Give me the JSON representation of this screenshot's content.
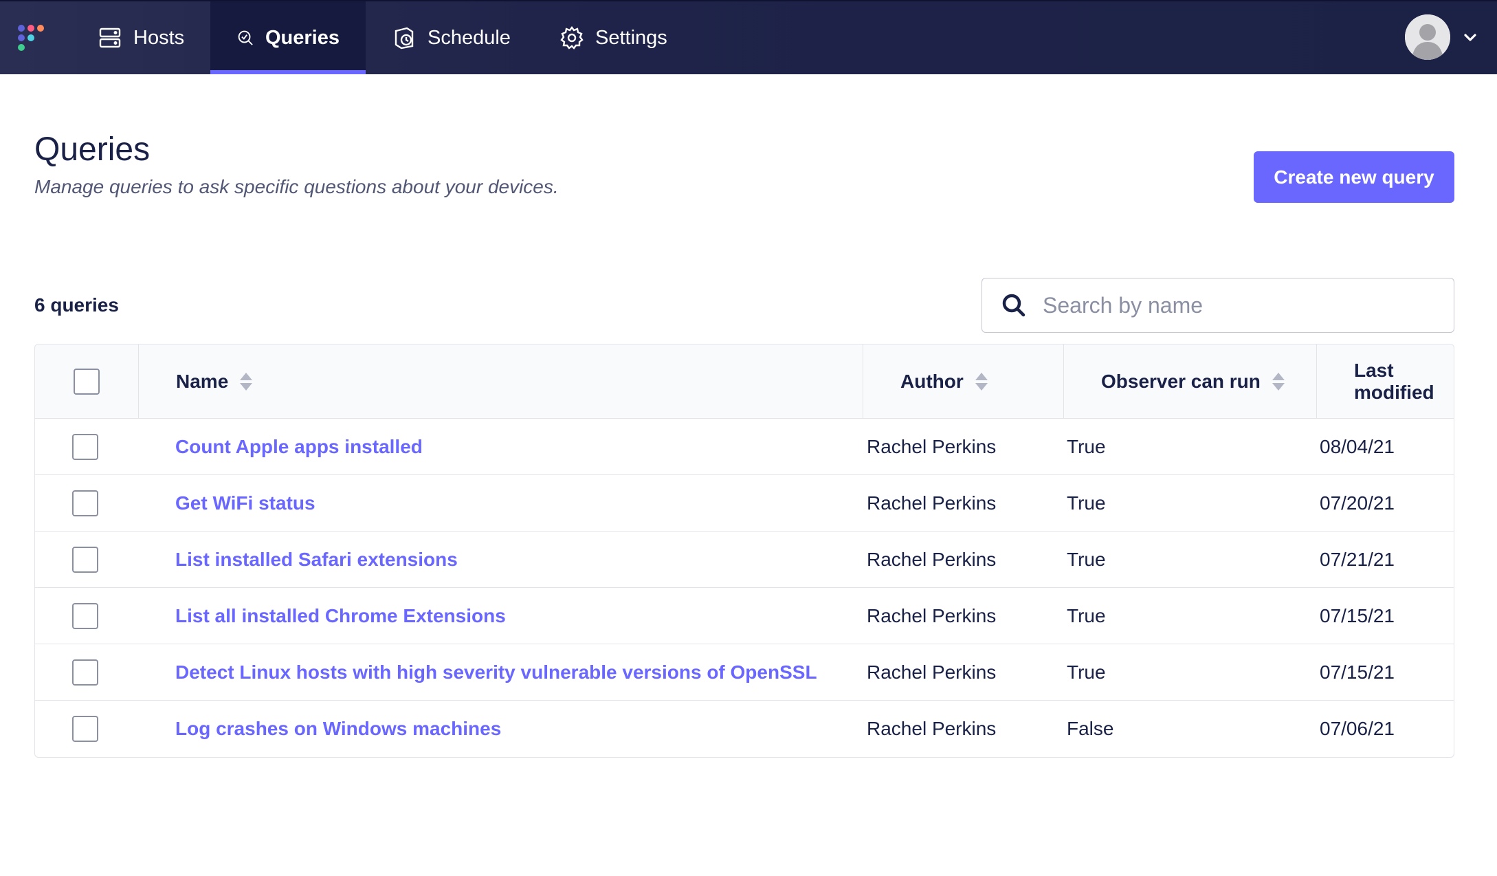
{
  "nav": {
    "items": [
      {
        "label": "Hosts",
        "icon": "hosts-icon"
      },
      {
        "label": "Queries",
        "icon": "queries-icon",
        "active": true
      },
      {
        "label": "Schedule",
        "icon": "schedule-icon"
      },
      {
        "label": "Settings",
        "icon": "gear-icon"
      }
    ]
  },
  "colors": {
    "nav_bg": "#1f2349",
    "accent": "#6a67fe",
    "text": "#192147",
    "border": "#e2e4ea"
  },
  "header": {
    "title": "Queries",
    "subtitle": "Manage queries to ask specific questions about your devices.",
    "create_button": "Create new query"
  },
  "list": {
    "count_label": "6 queries",
    "search_placeholder": "Search by name",
    "search_value": ""
  },
  "table": {
    "columns": [
      "Name",
      "Author",
      "Observer can run",
      "Last modified"
    ],
    "rows": [
      {
        "name": "Count Apple apps installed",
        "author": "Rachel Perkins",
        "observer_can_run": "True",
        "last_modified": "08/04/21"
      },
      {
        "name": "Get WiFi status",
        "author": "Rachel Perkins",
        "observer_can_run": "True",
        "last_modified": "07/20/21"
      },
      {
        "name": "List installed Safari extensions",
        "author": "Rachel Perkins",
        "observer_can_run": "True",
        "last_modified": "07/21/21"
      },
      {
        "name": "List all installed Chrome Extensions",
        "author": "Rachel Perkins",
        "observer_can_run": "True",
        "last_modified": "07/15/21"
      },
      {
        "name": "Detect Linux hosts with high severity vulnerable versions of OpenSSL",
        "author": "Rachel Perkins",
        "observer_can_run": "True",
        "last_modified": "07/15/21"
      },
      {
        "name": "Log crashes on Windows machines",
        "author": "Rachel Perkins",
        "observer_can_run": "False",
        "last_modified": "07/06/21"
      }
    ]
  }
}
